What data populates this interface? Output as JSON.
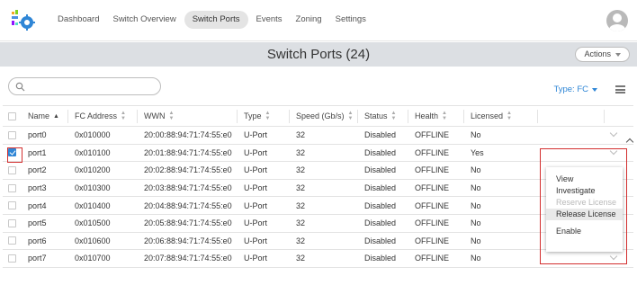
{
  "nav": {
    "items": [
      {
        "label": "Dashboard",
        "active": false
      },
      {
        "label": "Switch Overview",
        "active": false
      },
      {
        "label": "Switch Ports",
        "active": true
      },
      {
        "label": "Events",
        "active": false
      },
      {
        "label": "Zoning",
        "active": false
      },
      {
        "label": "Settings",
        "active": false
      }
    ],
    "logo_icon": "gear-logo-icon",
    "avatar_icon": "user-avatar-icon"
  },
  "titlebar": {
    "title": "Switch Ports (24)",
    "actions_label": "Actions"
  },
  "toolbar": {
    "search_placeholder": "",
    "type_filter_label": "Type: FC",
    "menu_icon": "hamburger-icon"
  },
  "table": {
    "columns": [
      "Name",
      "FC Address",
      "WWN",
      "Type",
      "Speed (Gb/s)",
      "Status",
      "Health",
      "Licensed"
    ],
    "sorted_column": "Name",
    "sort_direction": "ascending",
    "rows": [
      {
        "name": "port0",
        "fc_address": "0x010000",
        "wwn": "20:00:88:94:71:74:55:e0",
        "type": "U-Port",
        "speed": "32",
        "status": "Disabled",
        "health": "OFFLINE",
        "licensed": "No",
        "checked": false
      },
      {
        "name": "port1",
        "fc_address": "0x010100",
        "wwn": "20:01:88:94:71:74:55:e0",
        "type": "U-Port",
        "speed": "32",
        "status": "Disabled",
        "health": "OFFLINE",
        "licensed": "Yes",
        "checked": true
      },
      {
        "name": "port2",
        "fc_address": "0x010200",
        "wwn": "20:02:88:94:71:74:55:e0",
        "type": "U-Port",
        "speed": "32",
        "status": "Disabled",
        "health": "OFFLINE",
        "licensed": "No",
        "checked": false
      },
      {
        "name": "port3",
        "fc_address": "0x010300",
        "wwn": "20:03:88:94:71:74:55:e0",
        "type": "U-Port",
        "speed": "32",
        "status": "Disabled",
        "health": "OFFLINE",
        "licensed": "No",
        "checked": false
      },
      {
        "name": "port4",
        "fc_address": "0x010400",
        "wwn": "20:04:88:94:71:74:55:e0",
        "type": "U-Port",
        "speed": "32",
        "status": "Disabled",
        "health": "OFFLINE",
        "licensed": "No",
        "checked": false
      },
      {
        "name": "port5",
        "fc_address": "0x010500",
        "wwn": "20:05:88:94:71:74:55:e0",
        "type": "U-Port",
        "speed": "32",
        "status": "Disabled",
        "health": "OFFLINE",
        "licensed": "No",
        "checked": false
      },
      {
        "name": "port6",
        "fc_address": "0x010600",
        "wwn": "20:06:88:94:71:74:55:e0",
        "type": "U-Port",
        "speed": "32",
        "status": "Disabled",
        "health": "OFFLINE",
        "licensed": "No",
        "checked": false
      },
      {
        "name": "port7",
        "fc_address": "0x010700",
        "wwn": "20:07:88:94:71:74:55:e0",
        "type": "U-Port",
        "speed": "32",
        "status": "Disabled",
        "health": "OFFLINE",
        "licensed": "No",
        "checked": false
      }
    ]
  },
  "context_menu": {
    "items": [
      {
        "label": "View",
        "disabled": false,
        "hover": false
      },
      {
        "label": "Investigate",
        "disabled": false,
        "hover": false
      },
      {
        "label": "Reserve License",
        "disabled": true,
        "hover": false
      },
      {
        "label": "Release License",
        "disabled": false,
        "hover": true
      },
      {
        "label": "Enable",
        "disabled": false,
        "hover": false
      }
    ]
  },
  "colors": {
    "accent": "#2f86d6",
    "highlight": "#d32f2f",
    "titlebar_bg": "#dcdfe3"
  }
}
